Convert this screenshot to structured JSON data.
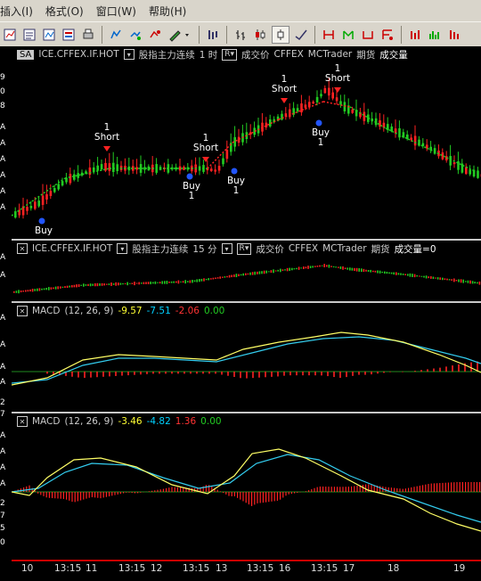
{
  "menu": [
    "插入(I)",
    "格式(O)",
    "窗口(W)",
    "帮助(H)"
  ],
  "left_labels": [
    "9",
    "0",
    "8",
    "A",
    "A",
    "A",
    "A",
    "A",
    "A",
    "A",
    "A",
    "A",
    "A",
    "A",
    "A",
    "A",
    "A",
    "A",
    "2",
    "7",
    "A",
    "A",
    "A",
    "A",
    "A",
    "A",
    "2",
    "7",
    "5",
    "0"
  ],
  "panel1": {
    "symbol_tag": "SA",
    "symbol": "ICE.CFFEX.IF.HOT",
    "name": "股指主力连续",
    "interval": "1 时",
    "r_label": "R",
    "field": "成交价",
    "exchange": "CFFEX",
    "source": "MCTrader",
    "kind": "期货",
    "vol_label": "成交量"
  },
  "panel2": {
    "symbol": "ICE.CFFEX.IF.HOT",
    "name": "股指主力连续",
    "interval": "15 分",
    "r_label": "R",
    "field": "成交价",
    "exchange": "CFFEX",
    "source": "MCTrader",
    "kind": "期货",
    "vol_label": "成交量=0"
  },
  "panel3": {
    "indicator": "MACD",
    "params": "(12, 26, 9)",
    "v1": "-9.57",
    "v2": "-7.51",
    "v3": "-2.06",
    "v4": "0.00"
  },
  "panel4": {
    "indicator": "MACD",
    "params": "(12, 26, 9)",
    "v1": "-3.46",
    "v2": "-4.82",
    "v3": "1.36",
    "v4": "0.00"
  },
  "signals": [
    {
      "text1": "Buy",
      "text2": ""
    },
    {
      "text1": "1",
      "text2": "Short"
    },
    {
      "text1": "1",
      "text2": "Short"
    },
    {
      "text1": "Buy",
      "text2": "1"
    },
    {
      "text1": "Buy",
      "text2": "1"
    },
    {
      "text1": "1",
      "text2": "Short"
    },
    {
      "text1": "Buy",
      "text2": "1"
    },
    {
      "text1": "1",
      "text2": "Short"
    }
  ],
  "x_axis": [
    "10",
    "13:15",
    "11",
    "13:15",
    "12",
    "13:15",
    "13",
    "13:15",
    "16",
    "13:15",
    "17",
    "18",
    "19"
  ],
  "colors": {
    "up": "#22cc22",
    "down": "#ff2222",
    "buy": "#2255ff",
    "short": "#ff2222",
    "dif": "#ffff66",
    "dea": "#33ccee"
  }
}
